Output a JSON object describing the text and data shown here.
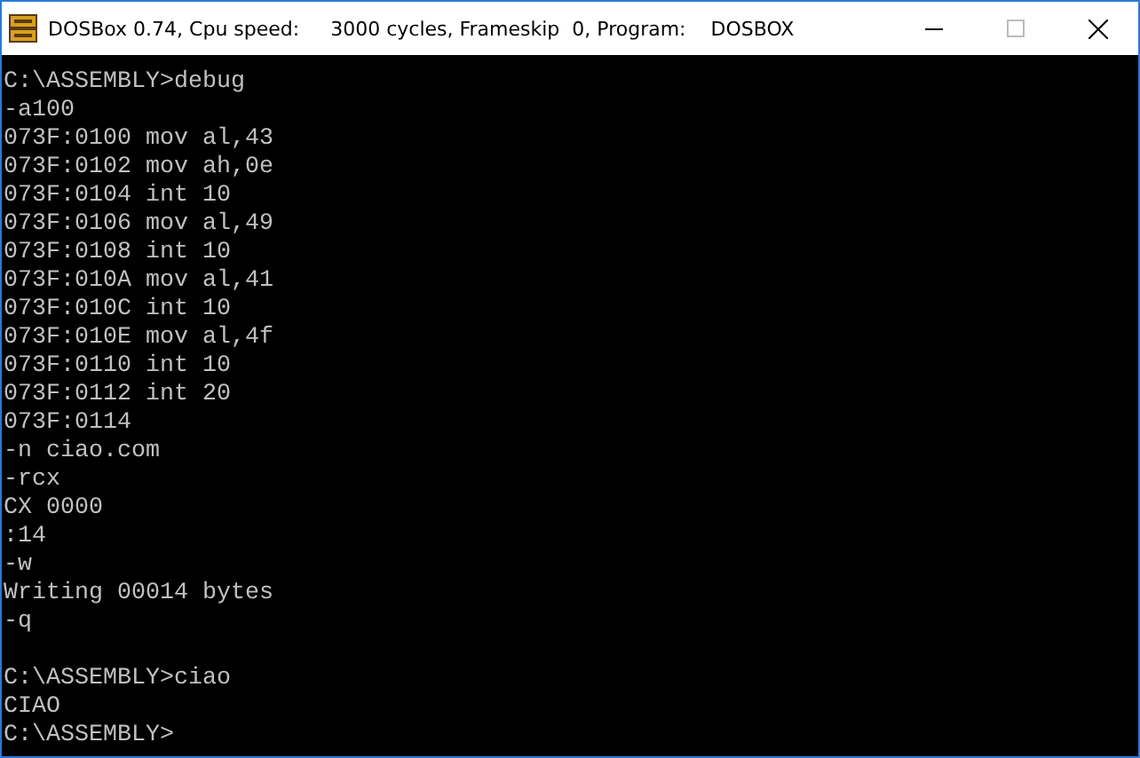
{
  "window": {
    "title": "DOSBox 0.74, Cpu speed:     3000 cycles, Frameskip  0, Program:    DOSBOX"
  },
  "console": {
    "blocks": [
      [
        "C:\\ASSEMBLY>debug",
        "-a100",
        "073F:0100 mov al,43",
        "073F:0102 mov ah,0e",
        "073F:0104 int 10",
        "073F:0106 mov al,49",
        "073F:0108 int 10",
        "073F:010A mov al,41",
        "073F:010C int 10",
        "073F:010E mov al,4f",
        "073F:0110 int 10",
        "073F:0112 int 20",
        "073F:0114",
        "-n ciao.com",
        "-rcx",
        "CX 0000",
        ":14",
        "-w",
        "Writing 00014 bytes",
        "-q"
      ],
      [
        "C:\\ASSEMBLY>ciao",
        "CIAO",
        "C:\\ASSEMBLY>"
      ]
    ]
  }
}
